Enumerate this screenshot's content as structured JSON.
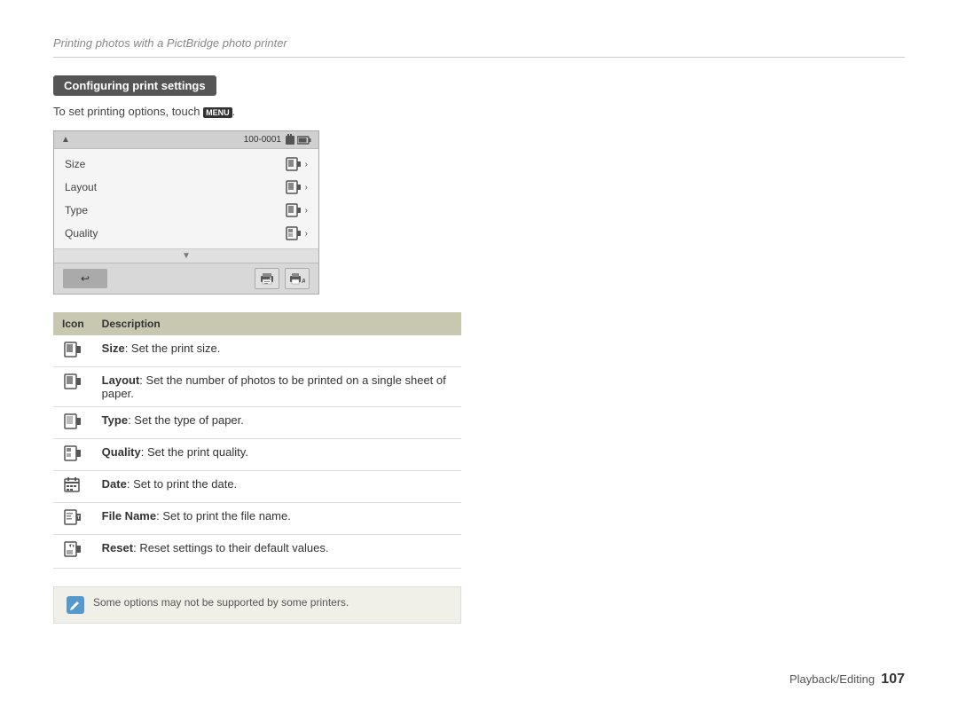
{
  "header": {
    "breadcrumb": "Printing photos with a PictBridge photo printer"
  },
  "section": {
    "title": "Configuring print settings",
    "intro": "To set printing options, touch",
    "menu_keyword": "MENU"
  },
  "camera_screen": {
    "up_arrow": "▲",
    "file_info": "100-0001",
    "menu_rows": [
      {
        "label": "Size"
      },
      {
        "label": "Layout"
      },
      {
        "label": "Type"
      },
      {
        "label": "Quality"
      }
    ],
    "down_arrow": "▼",
    "back_button": "↩"
  },
  "table": {
    "header_icon": "Icon",
    "header_desc": "Description",
    "rows": [
      {
        "icon_label": "size-icon",
        "bold": "Size",
        "text": ": Set the print size."
      },
      {
        "icon_label": "layout-icon",
        "bold": "Layout",
        "text": ": Set the number of photos to be printed on a single sheet of paper."
      },
      {
        "icon_label": "type-icon",
        "bold": "Type",
        "text": ": Set the type of paper."
      },
      {
        "icon_label": "quality-icon",
        "bold": "Quality",
        "text": ": Set the print quality."
      },
      {
        "icon_label": "date-icon",
        "bold": "Date",
        "text": ": Set to print the date."
      },
      {
        "icon_label": "filename-icon",
        "bold": "File Name",
        "text": ": Set to print the file name."
      },
      {
        "icon_label": "reset-icon",
        "bold": "Reset",
        "text": ": Reset settings to their default values."
      }
    ]
  },
  "note": {
    "icon": "✎",
    "text": "Some options may not be supported by some printers."
  },
  "footer": {
    "label": "Playback/Editing",
    "page": "107"
  }
}
